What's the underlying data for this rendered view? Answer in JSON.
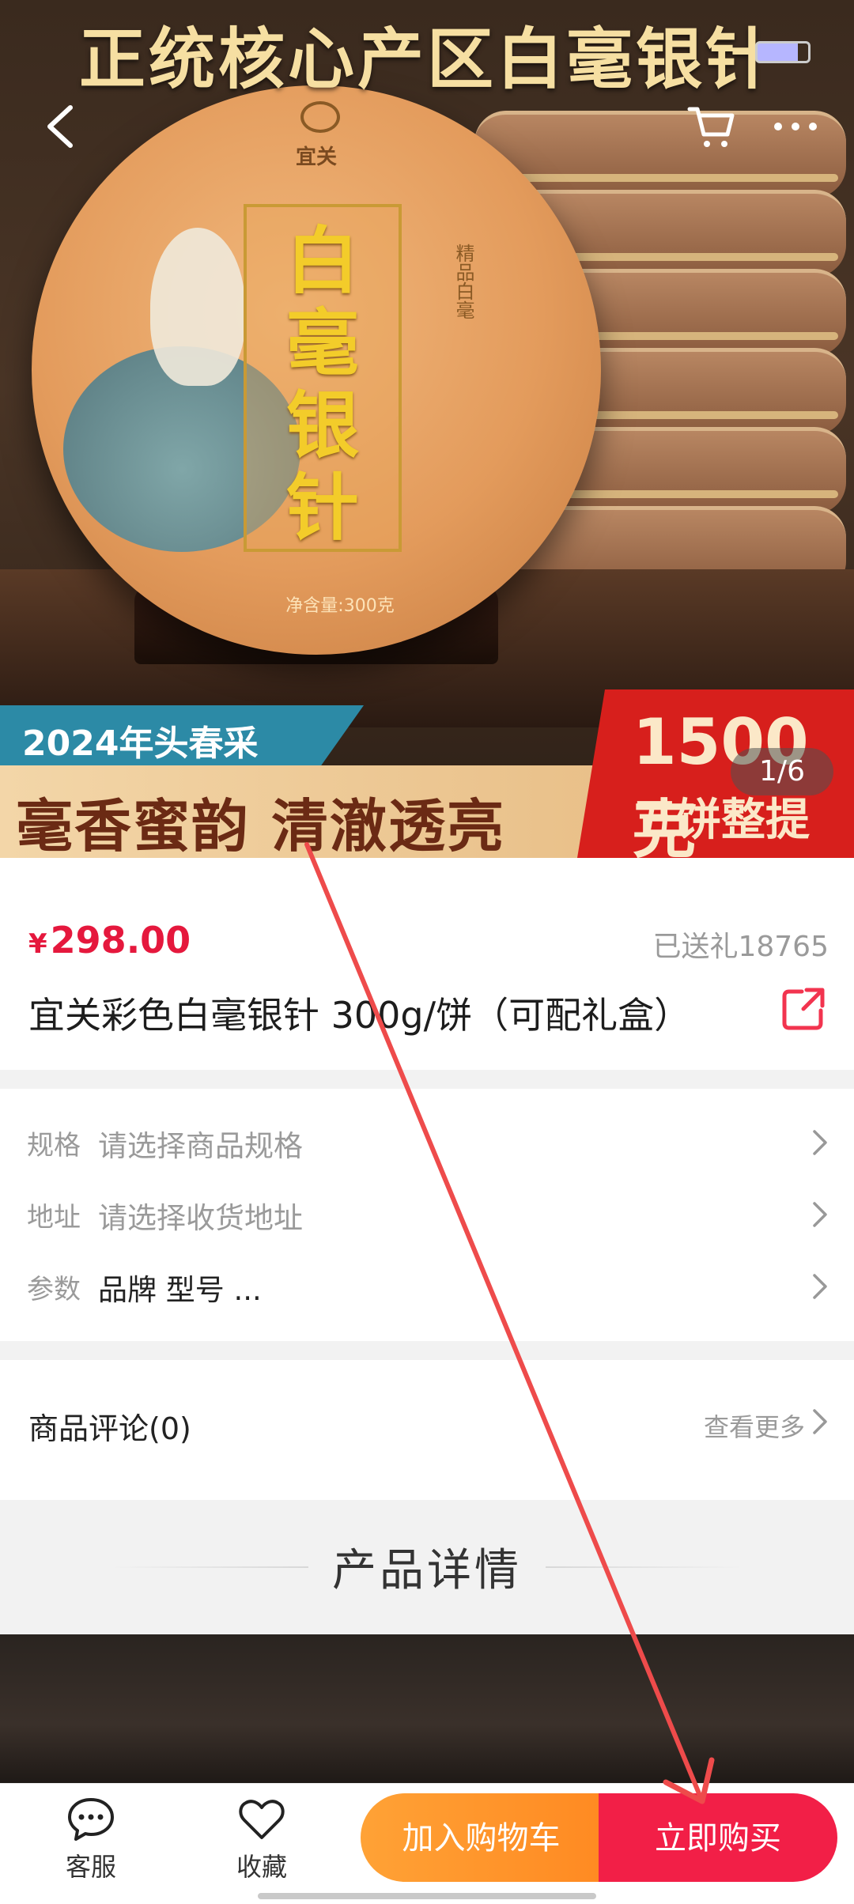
{
  "hero": {
    "banner_title": "正统核心产区白毫银针",
    "brand": "宜关",
    "cake_label": "白毫银针",
    "side_text": "精品白毫",
    "net_weight": "净含量:300克",
    "tag_year": "2024年头春采",
    "slogan": "毫香蜜韵 清澈透亮",
    "promo_weight": "1500克",
    "promo_text": "五饼整提",
    "image_counter": "1/6"
  },
  "product": {
    "currency": "¥",
    "price": "298.00",
    "gifted": "已送礼18765",
    "title": "宜关彩色白毫银针 300g/饼（可配礼盒）"
  },
  "options": [
    {
      "key": "规格",
      "value": "请选择商品规格"
    },
    {
      "key": "地址",
      "value": "请选择收货地址"
    },
    {
      "key": "参数",
      "value": "品牌 型号 ..."
    }
  ],
  "reviews": {
    "title": "商品评论(0)",
    "more": "查看更多"
  },
  "detail": {
    "title": "产品详情"
  },
  "bottom_bar": {
    "service_label": "客服",
    "favorite_label": "收藏",
    "add_to_cart": "加入购物车",
    "buy_now": "立即购买"
  },
  "colors": {
    "price_red": "#e5183d",
    "cart_orange": "#ff9a2e",
    "buy_red": "#f21f47",
    "annotation_arrow": "#ee4b4b"
  },
  "icons": [
    "back-icon",
    "cart-icon",
    "more-icon",
    "share-icon",
    "chevron-right-icon",
    "chat-bubble-icon",
    "heart-icon"
  ]
}
